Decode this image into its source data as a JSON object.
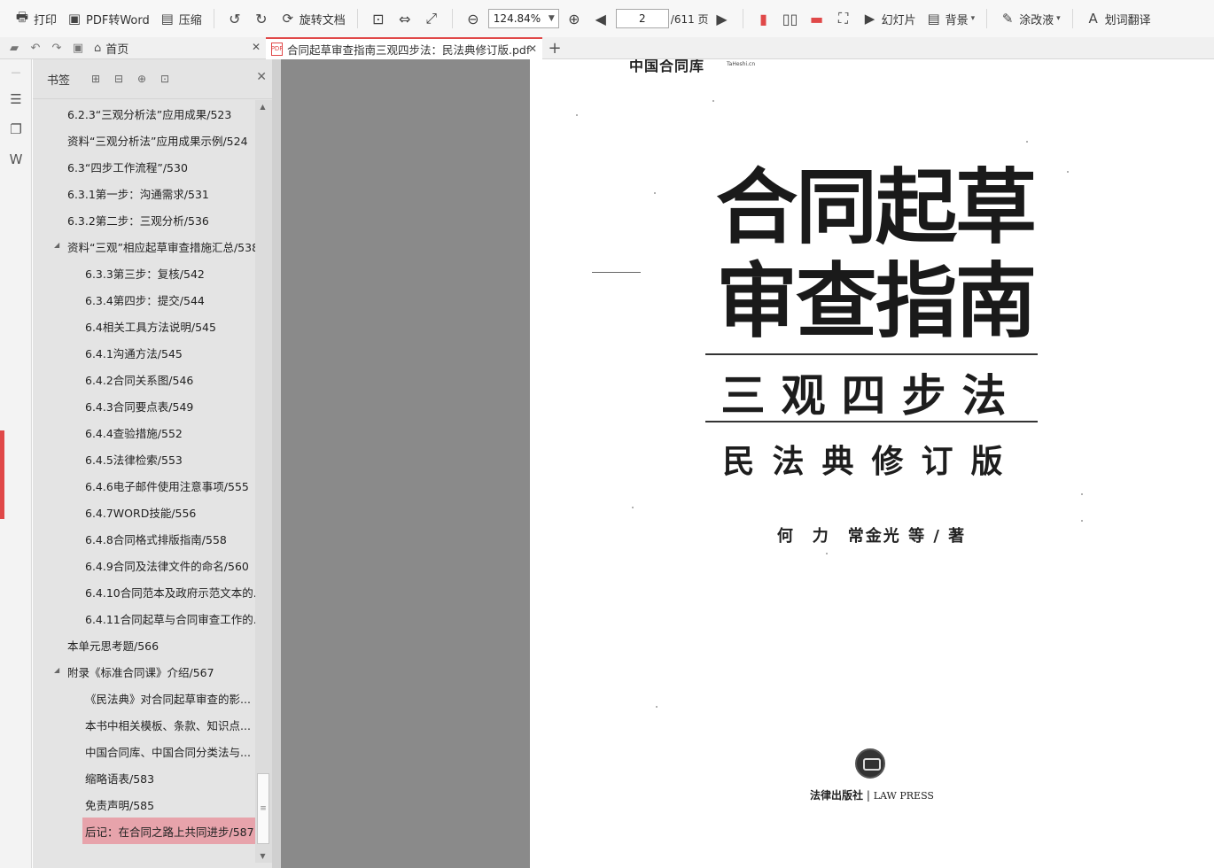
{
  "toolbar": {
    "print": "打印",
    "pdf_to_word": "PDF转Word",
    "compress": "压缩",
    "rotate_doc": "旋转文档",
    "zoom_value": "124.84%",
    "current_page": "2",
    "total_pages": "/611 页",
    "slideshow": "幻灯片",
    "background": "背景",
    "whiteout": "涂改液",
    "translate": "划词翻译"
  },
  "tabs": {
    "home": "首页",
    "document": "合同起草审查指南三观四步法：民法典修订版.pdf"
  },
  "bookmark_panel": {
    "title": "书签",
    "items": [
      {
        "label": "6.2.3“三观分析法”应用成果/523",
        "level": 1
      },
      {
        "label": "资料“三观分析法”应用成果示例/524",
        "level": 1
      },
      {
        "label": "6.3“四步工作流程”/530",
        "level": 1
      },
      {
        "label": "6.3.1第一步：沟通需求/531",
        "level": 1
      },
      {
        "label": "6.3.2第二步：三观分析/536",
        "level": 1
      },
      {
        "label": "资料“三观”相应起草审查措施汇总/538",
        "level": 1,
        "expanded": true
      },
      {
        "label": "6.3.3第三步：复核/542",
        "level": 2
      },
      {
        "label": "6.3.4第四步：提交/544",
        "level": 2
      },
      {
        "label": "6.4相关工具方法说明/545",
        "level": 2
      },
      {
        "label": "6.4.1沟通方法/545",
        "level": 2
      },
      {
        "label": "6.4.2合同关系图/546",
        "level": 2
      },
      {
        "label": "6.4.3合同要点表/549",
        "level": 2
      },
      {
        "label": "6.4.4查验措施/552",
        "level": 2
      },
      {
        "label": "6.4.5法律检索/553",
        "level": 2
      },
      {
        "label": "6.4.6电子邮件使用注意事项/555",
        "level": 2
      },
      {
        "label": "6.4.7WORD技能/556",
        "level": 2
      },
      {
        "label": "6.4.8合同格式排版指南/558",
        "level": 2
      },
      {
        "label": "6.4.9合同及法律文件的命名/560",
        "level": 2
      },
      {
        "label": "6.4.10合同范本及政府示范文本的...",
        "level": 2
      },
      {
        "label": "6.4.11合同起草与合同审查工作的...",
        "level": 2
      },
      {
        "label": "本单元思考题/566",
        "level": 1
      },
      {
        "label": "附录《标准合同课》介绍/567",
        "level": 1,
        "expanded": true
      },
      {
        "label": "《民法典》对合同起草审查的影...",
        "level": 2
      },
      {
        "label": "本书中相关模板、条款、知识点...",
        "level": 2
      },
      {
        "label": "中国合同库、中国合同分类法与...",
        "level": 2
      },
      {
        "label": "缩略语表/583",
        "level": 2
      },
      {
        "label": "免责声明/585",
        "level": 2
      },
      {
        "label": "后记：在合同之路上共同进步/587",
        "level": 2,
        "selected": true
      }
    ]
  },
  "page": {
    "publisher_top": "中国合同库",
    "publisher_top_small": "TaHeshi.cn",
    "title_line1": "合同起草",
    "title_line2": "审查指南",
    "subtitle": "三观四步法",
    "edition": "民法典修订版",
    "authors": "何　力　常金光 等 / 著",
    "press_cn": "法律出版社",
    "press_sep": "|",
    "press_en": "LAW PRESS"
  },
  "colors": {
    "accent": "#e04848",
    "selected_bookmark": "#e7a3ab",
    "viewer_bg": "#8a8a8a",
    "panel_bg": "#e4e4e4"
  }
}
